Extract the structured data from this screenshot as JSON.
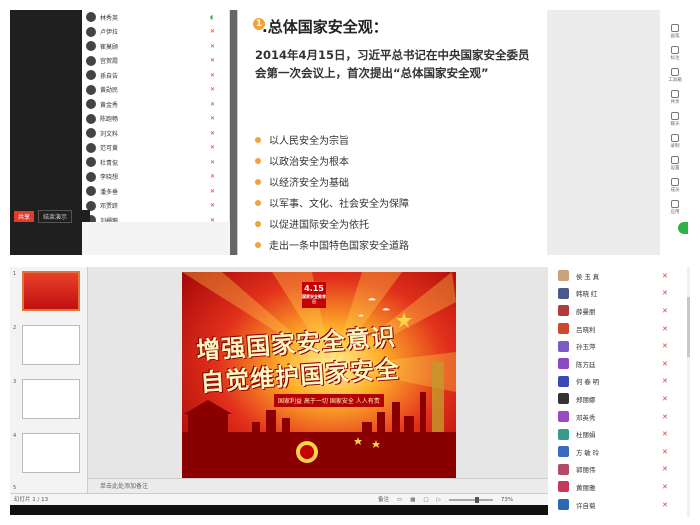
{
  "top": {
    "members": [
      {
        "name": "林秀英",
        "mic": "on"
      },
      {
        "name": "卢伊拉",
        "mic": "off"
      },
      {
        "name": "崔莫顾",
        "mic": "off"
      },
      {
        "name": "宫贺霞",
        "mic": "off"
      },
      {
        "name": "孫自告",
        "mic": "off"
      },
      {
        "name": "黄勋民",
        "mic": "off"
      },
      {
        "name": "黄金秀",
        "mic": "off"
      },
      {
        "name": "陈跑畅",
        "mic": "off"
      },
      {
        "name": "刘文料",
        "mic": "off"
      },
      {
        "name": "范可黄",
        "mic": "off"
      },
      {
        "name": "杜青侃",
        "mic": "off"
      },
      {
        "name": "李晓想",
        "mic": "off"
      },
      {
        "name": "潘多垂",
        "mic": "off"
      },
      {
        "name": "邓贾跻",
        "mic": "off"
      },
      {
        "name": "刘栅鹅",
        "mic": "off"
      }
    ],
    "share_label": "共享",
    "end_label": "结束演示",
    "slide": {
      "num": "1",
      "title": ".总体国家安全观：",
      "intro": "2014年4月15日，习近平总书记在中央国家安全委员会第一次会议上，首次提出“总体国家安全观”",
      "bullets": [
        "以人民安全为宗旨",
        "以政治安全为根本",
        "以经济安全为基础",
        "以军事、文化、社会安全为保障",
        "以促进国际安全为依托",
        "走出一条中国特色国家安全道路"
      ]
    },
    "tools": [
      "画笔",
      "标注",
      "工具箱",
      "共享",
      "聊天",
      "录制",
      "设置",
      "成员",
      "应用"
    ]
  },
  "bottom": {
    "thumb_numbers": [
      "1",
      "2",
      "3",
      "4",
      "5"
    ],
    "poster": {
      "date_main": "4.15",
      "date_sub": "国家安全教育日",
      "title_line1": "增强国家安全意识",
      "title_line2": "自觉维护国家安全",
      "subtitle": "国家利益 高于一切 国家安全 人人有责"
    },
    "notes_placeholder": "单击此处添加备注",
    "status_left": "幻灯片 1 / 13",
    "status_notes": "备注",
    "status_zoom": "73%",
    "members": [
      {
        "name": "侯 玉 真",
        "color": "#c9a37a"
      },
      {
        "name": "韩晓 红",
        "color": "#4a5a8a"
      },
      {
        "name": "薛曼丽",
        "color": "#b23a3a"
      },
      {
        "name": "吕晓利",
        "color": "#c94a2c"
      },
      {
        "name": "孙玉萍",
        "color": "#7a5cc4"
      },
      {
        "name": "陈方廷",
        "color": "#8a4ac4"
      },
      {
        "name": "何 春 明",
        "color": "#3a4ab2"
      },
      {
        "name": "郑丽娜",
        "color": "#333333"
      },
      {
        "name": "邓英秀",
        "color": "#9a4ac4"
      },
      {
        "name": "杜丽娟",
        "color": "#3a9a8a"
      },
      {
        "name": "方 敏 玲",
        "color": "#3a6ac4"
      },
      {
        "name": "郭丽伟",
        "color": "#b24a6a"
      },
      {
        "name": "黄丽雅",
        "color": "#c43a5a"
      },
      {
        "name": "许自菊",
        "color": "#2a6ab2"
      }
    ]
  }
}
